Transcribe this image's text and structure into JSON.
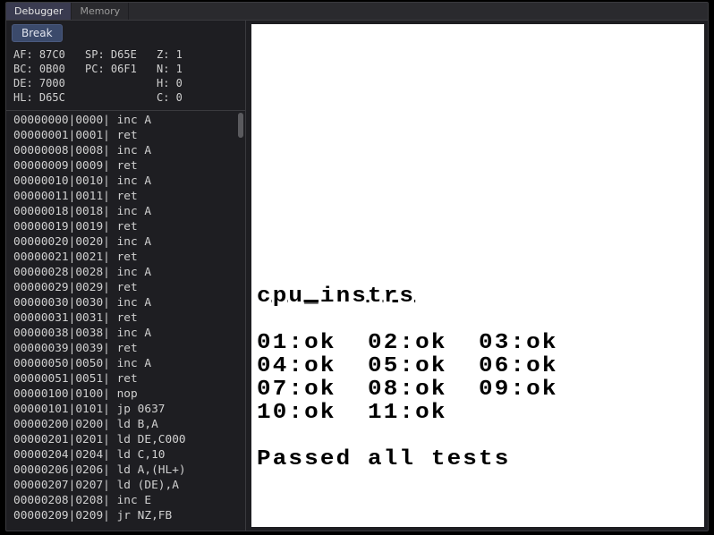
{
  "tabs": {
    "debugger": "Debugger",
    "memory": "Memory"
  },
  "toolbar": {
    "break": "Break"
  },
  "registers": {
    "r0": [
      "AF: 87C0",
      "SP: D65E",
      "Z: 1"
    ],
    "r1": [
      "BC: 0B00",
      "PC: 06F1",
      "N: 1"
    ],
    "r2": [
      "DE: 7000",
      "",
      "H: 0"
    ],
    "r3": [
      "HL: D65C",
      "",
      "C: 0"
    ]
  },
  "disasm": [
    "00000000|0000| inc A",
    "00000001|0001| ret",
    "00000008|0008| inc A",
    "00000009|0009| ret",
    "00000010|0010| inc A",
    "00000011|0011| ret",
    "00000018|0018| inc A",
    "00000019|0019| ret",
    "00000020|0020| inc A",
    "00000021|0021| ret",
    "00000028|0028| inc A",
    "00000029|0029| ret",
    "00000030|0030| inc A",
    "00000031|0031| ret",
    "00000038|0038| inc A",
    "00000039|0039| ret",
    "00000050|0050| inc A",
    "00000051|0051| ret",
    "00000100|0100| nop",
    "00000101|0101| jp 0637",
    "00000200|0200| ld B,A",
    "00000201|0201| ld DE,C000",
    "00000204|0204| ld C,10",
    "00000206|0206| ld A,(HL+)",
    "00000207|0207| ld (DE),A",
    "00000208|0208| inc E",
    "00000209|0209| jr NZ,FB"
  ],
  "screen": {
    "title": "cpu_instrs",
    "results": [
      "01:ok  02:ok  03:ok",
      "04:ok  05:ok  06:ok",
      "07:ok  08:ok  09:ok",
      "10:ok  11:ok"
    ],
    "passed": "Passed all tests"
  }
}
